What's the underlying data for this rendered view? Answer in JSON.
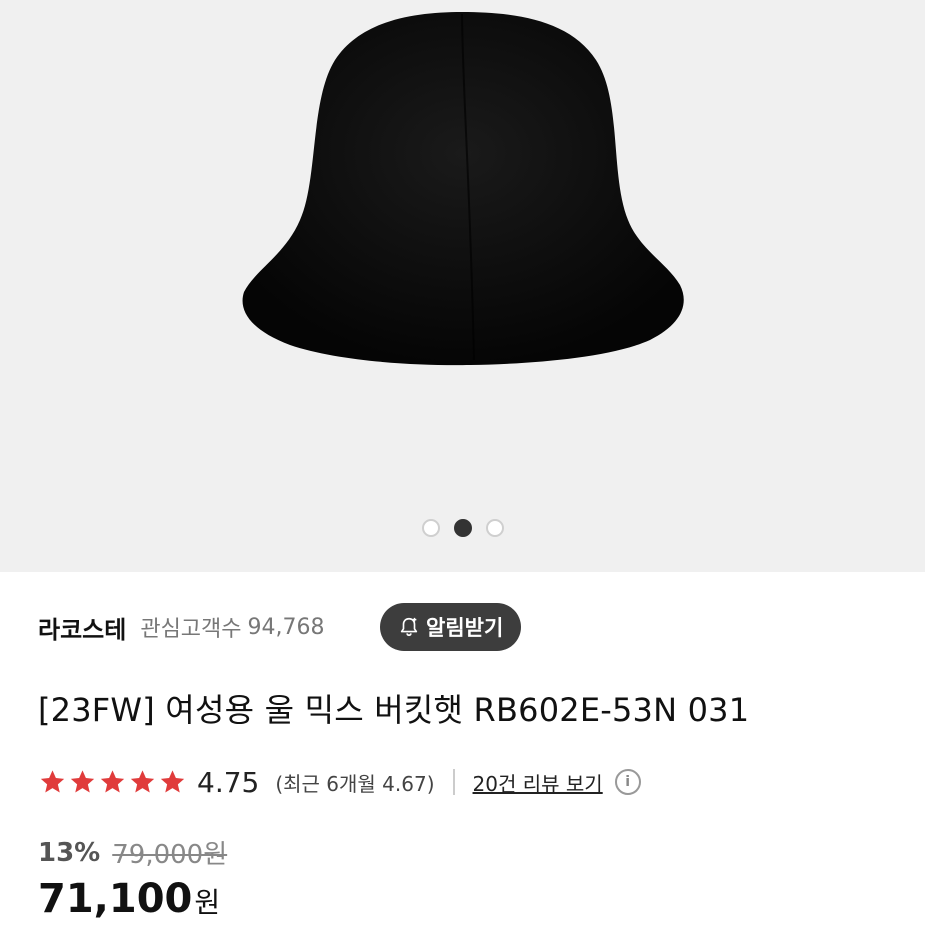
{
  "carousel": {
    "total_images": 3,
    "active_index": 1
  },
  "brand": {
    "name": "라코스테",
    "fans_label": "관심고객수",
    "fans_count": "94,768",
    "notify_label": "알림받기"
  },
  "product": {
    "title": "[23FW] 여성용 울 믹스 버킷햇 RB602E-53N 031"
  },
  "rating": {
    "stars": 5,
    "value": "4.75",
    "recent": "(최근 6개월 4.67)",
    "review_link": "20건 리뷰 보기",
    "star_color": "#e03b3b"
  },
  "pricing": {
    "discount": "13%",
    "original_price": "79,000원",
    "price": "71,100",
    "currency": "원"
  },
  "icons": {
    "notify": "bell-plus-icon",
    "info": "info-icon",
    "star": "star-icon"
  }
}
